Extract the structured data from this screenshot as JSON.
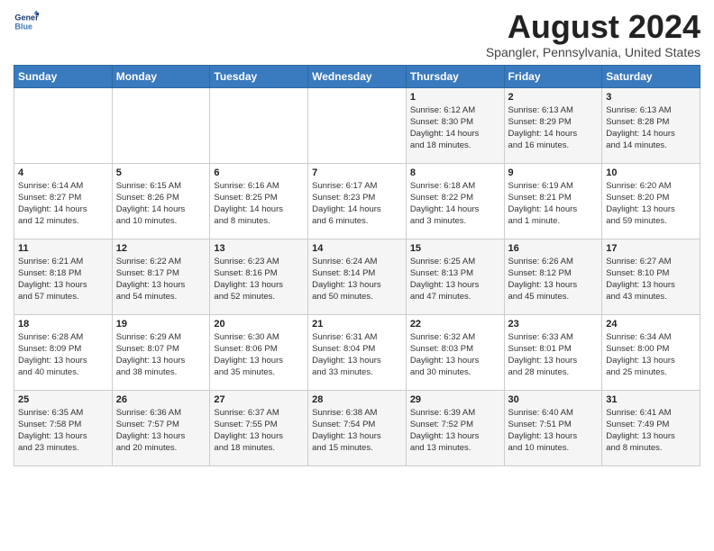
{
  "header": {
    "logo_line1": "General",
    "logo_line2": "Blue",
    "month_year": "August 2024",
    "location": "Spangler, Pennsylvania, United States"
  },
  "weekdays": [
    "Sunday",
    "Monday",
    "Tuesday",
    "Wednesday",
    "Thursday",
    "Friday",
    "Saturday"
  ],
  "weeks": [
    [
      {
        "day": "",
        "info": ""
      },
      {
        "day": "",
        "info": ""
      },
      {
        "day": "",
        "info": ""
      },
      {
        "day": "",
        "info": ""
      },
      {
        "day": "1",
        "info": "Sunrise: 6:12 AM\nSunset: 8:30 PM\nDaylight: 14 hours\nand 18 minutes."
      },
      {
        "day": "2",
        "info": "Sunrise: 6:13 AM\nSunset: 8:29 PM\nDaylight: 14 hours\nand 16 minutes."
      },
      {
        "day": "3",
        "info": "Sunrise: 6:13 AM\nSunset: 8:28 PM\nDaylight: 14 hours\nand 14 minutes."
      }
    ],
    [
      {
        "day": "4",
        "info": "Sunrise: 6:14 AM\nSunset: 8:27 PM\nDaylight: 14 hours\nand 12 minutes."
      },
      {
        "day": "5",
        "info": "Sunrise: 6:15 AM\nSunset: 8:26 PM\nDaylight: 14 hours\nand 10 minutes."
      },
      {
        "day": "6",
        "info": "Sunrise: 6:16 AM\nSunset: 8:25 PM\nDaylight: 14 hours\nand 8 minutes."
      },
      {
        "day": "7",
        "info": "Sunrise: 6:17 AM\nSunset: 8:23 PM\nDaylight: 14 hours\nand 6 minutes."
      },
      {
        "day": "8",
        "info": "Sunrise: 6:18 AM\nSunset: 8:22 PM\nDaylight: 14 hours\nand 3 minutes."
      },
      {
        "day": "9",
        "info": "Sunrise: 6:19 AM\nSunset: 8:21 PM\nDaylight: 14 hours\nand 1 minute."
      },
      {
        "day": "10",
        "info": "Sunrise: 6:20 AM\nSunset: 8:20 PM\nDaylight: 13 hours\nand 59 minutes."
      }
    ],
    [
      {
        "day": "11",
        "info": "Sunrise: 6:21 AM\nSunset: 8:18 PM\nDaylight: 13 hours\nand 57 minutes."
      },
      {
        "day": "12",
        "info": "Sunrise: 6:22 AM\nSunset: 8:17 PM\nDaylight: 13 hours\nand 54 minutes."
      },
      {
        "day": "13",
        "info": "Sunrise: 6:23 AM\nSunset: 8:16 PM\nDaylight: 13 hours\nand 52 minutes."
      },
      {
        "day": "14",
        "info": "Sunrise: 6:24 AM\nSunset: 8:14 PM\nDaylight: 13 hours\nand 50 minutes."
      },
      {
        "day": "15",
        "info": "Sunrise: 6:25 AM\nSunset: 8:13 PM\nDaylight: 13 hours\nand 47 minutes."
      },
      {
        "day": "16",
        "info": "Sunrise: 6:26 AM\nSunset: 8:12 PM\nDaylight: 13 hours\nand 45 minutes."
      },
      {
        "day": "17",
        "info": "Sunrise: 6:27 AM\nSunset: 8:10 PM\nDaylight: 13 hours\nand 43 minutes."
      }
    ],
    [
      {
        "day": "18",
        "info": "Sunrise: 6:28 AM\nSunset: 8:09 PM\nDaylight: 13 hours\nand 40 minutes."
      },
      {
        "day": "19",
        "info": "Sunrise: 6:29 AM\nSunset: 8:07 PM\nDaylight: 13 hours\nand 38 minutes."
      },
      {
        "day": "20",
        "info": "Sunrise: 6:30 AM\nSunset: 8:06 PM\nDaylight: 13 hours\nand 35 minutes."
      },
      {
        "day": "21",
        "info": "Sunrise: 6:31 AM\nSunset: 8:04 PM\nDaylight: 13 hours\nand 33 minutes."
      },
      {
        "day": "22",
        "info": "Sunrise: 6:32 AM\nSunset: 8:03 PM\nDaylight: 13 hours\nand 30 minutes."
      },
      {
        "day": "23",
        "info": "Sunrise: 6:33 AM\nSunset: 8:01 PM\nDaylight: 13 hours\nand 28 minutes."
      },
      {
        "day": "24",
        "info": "Sunrise: 6:34 AM\nSunset: 8:00 PM\nDaylight: 13 hours\nand 25 minutes."
      }
    ],
    [
      {
        "day": "25",
        "info": "Sunrise: 6:35 AM\nSunset: 7:58 PM\nDaylight: 13 hours\nand 23 minutes."
      },
      {
        "day": "26",
        "info": "Sunrise: 6:36 AM\nSunset: 7:57 PM\nDaylight: 13 hours\nand 20 minutes."
      },
      {
        "day": "27",
        "info": "Sunrise: 6:37 AM\nSunset: 7:55 PM\nDaylight: 13 hours\nand 18 minutes."
      },
      {
        "day": "28",
        "info": "Sunrise: 6:38 AM\nSunset: 7:54 PM\nDaylight: 13 hours\nand 15 minutes."
      },
      {
        "day": "29",
        "info": "Sunrise: 6:39 AM\nSunset: 7:52 PM\nDaylight: 13 hours\nand 13 minutes."
      },
      {
        "day": "30",
        "info": "Sunrise: 6:40 AM\nSunset: 7:51 PM\nDaylight: 13 hours\nand 10 minutes."
      },
      {
        "day": "31",
        "info": "Sunrise: 6:41 AM\nSunset: 7:49 PM\nDaylight: 13 hours\nand 8 minutes."
      }
    ]
  ]
}
